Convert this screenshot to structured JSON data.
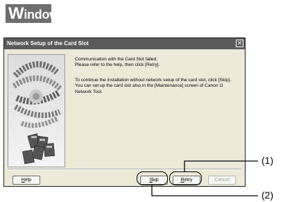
{
  "brand": {
    "initial": "W",
    "rest": "indows"
  },
  "dialog": {
    "title": "Network Setup of the Card Slot",
    "close_glyph": "✕",
    "message_line1": "Communication with the Card Slot failed.",
    "message_line2": "Please refer to the help, then click [Retry].",
    "message_line3": "To continue the installation without network setup of the card slot, click [Skip].",
    "message_line4": "You can set up the card slot also in the [Maintenance] screen of Canon IJ",
    "message_line5": "Network Tool.",
    "buttons": {
      "help": {
        "mnemonic": "H",
        "rest": "elp"
      },
      "skip": {
        "mnemonic": "S",
        "rest": "kip"
      },
      "retry": {
        "mnemonic": "R",
        "rest": "etry"
      },
      "cancel": "Cancel"
    }
  },
  "callouts": {
    "retry_label": "(1)",
    "skip_label": "(2)"
  }
}
